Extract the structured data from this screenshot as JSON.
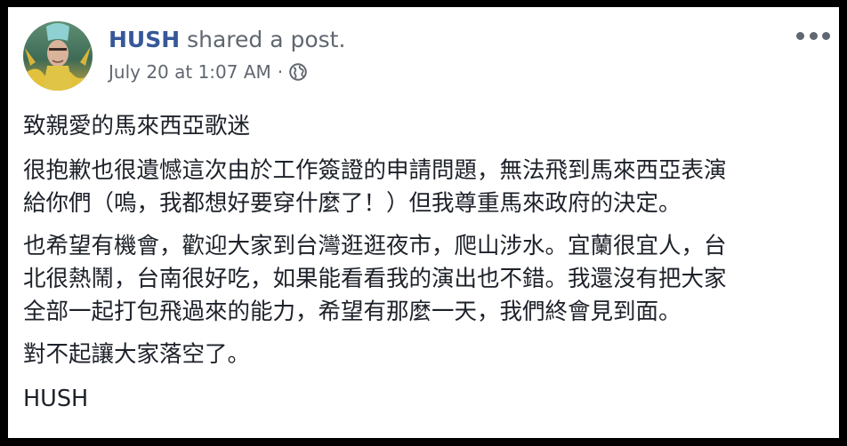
{
  "post": {
    "author": "HUSH",
    "action": " shared a post.",
    "timestamp": "July 20 at 1:07 AM",
    "separator": "·",
    "privacy_icon": "globe-icon",
    "more_icon": "more-options-icon",
    "colors": {
      "author_link": "#365899",
      "meta_text": "#616770",
      "body_text": "#1d2129",
      "frame": "#000000"
    }
  },
  "content": {
    "greeting": "致親愛的馬來西亞歌迷",
    "para1_line1": "很抱歉也很遺憾這次由於工作簽證的申請問題，無法飛到馬來西亞表演",
    "para1_line2": "給你們（嗚，我都想好要穿什麼了！）但我尊重馬來政府的決定。",
    "para2_line1": "也希望有機會，歡迎大家到台灣逛逛夜市，爬山涉水。宜蘭很宜人，台",
    "para2_line2": "北很熱鬧，台南很好吃，如果能看看我的演出也不錯。我還沒有把大家",
    "para2_line3": "全部一起打包飛過來的能力，希望有那麼一天，我們終會見到面。",
    "apology": "對不起讓大家落空了。",
    "signature": "HUSH"
  }
}
